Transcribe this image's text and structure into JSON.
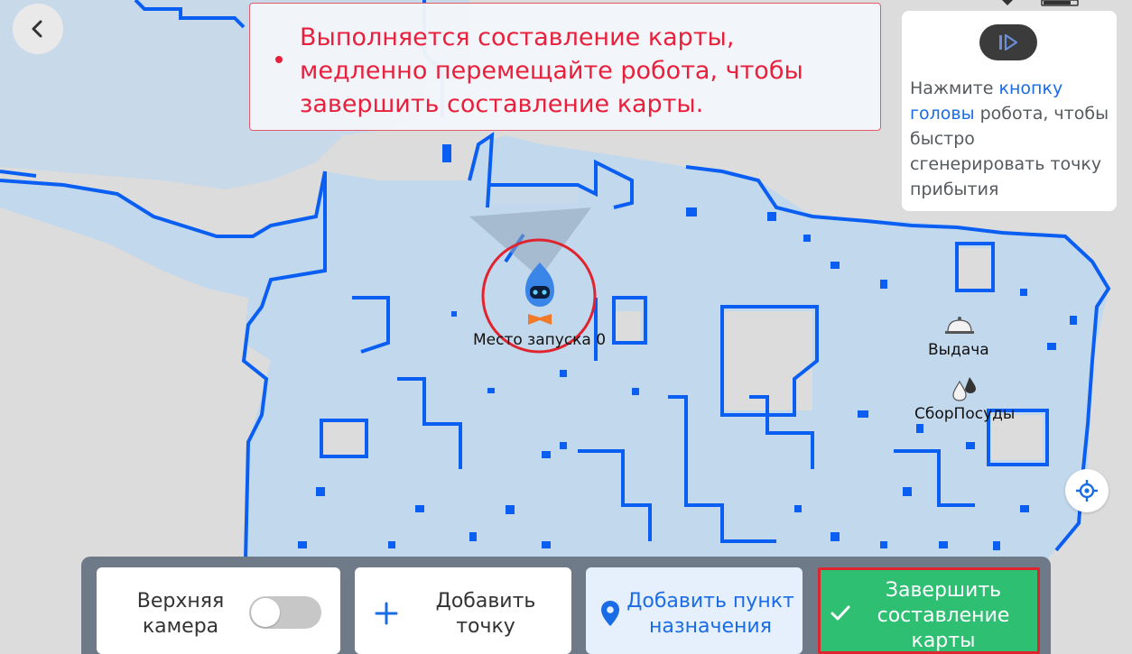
{
  "colors": {
    "map_fill": "#c2d8ec",
    "map_wall": "#0a5ff2",
    "background": "#dcdcdc",
    "notice_text": "#e8203c",
    "link": "#1a6be6",
    "finish_green": "#2fbf73",
    "highlight_red": "#e0242f"
  },
  "header": {
    "back_icon": "chevron-left-icon"
  },
  "notice": {
    "lines": [
      "Выполняется составление карты,",
      "медленно перемещайте робота, чтобы",
      "завершить составление карты."
    ]
  },
  "tip": {
    "button_icon": "play-pause-icon",
    "text_before": "Нажмите ",
    "link_text": "кнопку головы",
    "text_after": " робота, чтобы быстро сгенерировать точку прибытия"
  },
  "map": {
    "robot_label": "Место запуска 0",
    "points": [
      {
        "label": "Выдача",
        "icon": "cloche-icon"
      },
      {
        "label": "СборПосуды",
        "icon": "dishes-icon"
      }
    ],
    "locate_icon": "locate-icon"
  },
  "bottom_bar": {
    "camera": {
      "label_line1": "Верхняя",
      "label_line2": "камера",
      "toggle_on": false
    },
    "add_point": {
      "icon": "plus-icon",
      "label_line1": "Добавить",
      "label_line2": "точку"
    },
    "add_destination": {
      "icon": "location-pin-icon",
      "label_line1": "Добавить пункт",
      "label_line2": "назначения"
    },
    "finish": {
      "icon": "check-icon",
      "label_line1": "Завершить",
      "label_line2": "составление",
      "label_line3": "карты"
    }
  }
}
